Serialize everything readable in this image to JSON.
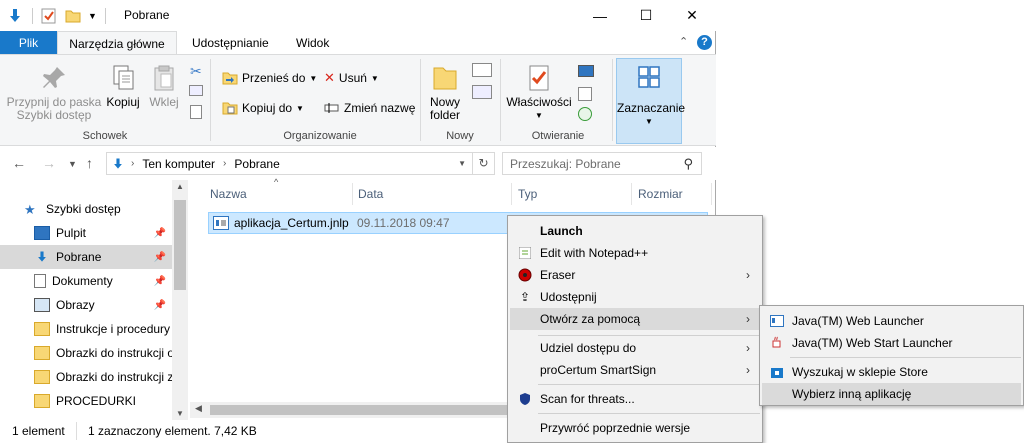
{
  "window": {
    "title": "Pobrane"
  },
  "tabs": {
    "file": "Plik",
    "home": "Narzędzia główne",
    "share": "Udostępnianie",
    "view": "Widok"
  },
  "ribbon": {
    "pin_label_1": "Przypnij do paska",
    "pin_label_2": "Szybki dostęp",
    "copy": "Kopiuj",
    "paste": "Wklej",
    "group_clipboard": "Schowek",
    "move_to": "Przenieś do",
    "copy_to": "Kopiuj do",
    "delete": "Usuń",
    "rename": "Zmień nazwę",
    "group_organize": "Organizowanie",
    "new_folder_1": "Nowy",
    "new_folder_2": "folder",
    "group_new": "Nowy",
    "properties": "Właściwości",
    "group_open": "Otwieranie",
    "select": "Zaznaczanie"
  },
  "address": {
    "crumb_1": "Ten komputer",
    "crumb_2": "Pobrane",
    "search_placeholder": "Przeszukaj: Pobrane"
  },
  "navpane": {
    "items": [
      {
        "label": "Szybki dostęp"
      },
      {
        "label": "Pulpit"
      },
      {
        "label": "Pobrane"
      },
      {
        "label": "Dokumenty"
      },
      {
        "label": "Obrazy"
      },
      {
        "label": "Instrukcje i procedury"
      },
      {
        "label": "Obrazki do instrukcji o"
      },
      {
        "label": "Obrazki do instrukcji z"
      },
      {
        "label": "PROCEDURKI"
      }
    ]
  },
  "filelist": {
    "columns": [
      "Nazwa",
      "Data",
      "Typ",
      "Rozmiar"
    ],
    "rows": [
      {
        "name": "aplikacja_Certum.jnlp",
        "date": "09.11.2018 09:47"
      }
    ]
  },
  "status": {
    "count": "1 element",
    "selected": "1 zaznaczony element. 7,42 KB"
  },
  "context_menu": {
    "items": [
      "Launch",
      "Edit with Notepad++",
      "Eraser",
      "Udostępnij",
      "Otwórz za pomocą",
      "Udziel dostępu do",
      "proCertum SmartSign",
      "Scan for threats...",
      "Przywróć poprzednie wersje"
    ]
  },
  "submenu": {
    "items": [
      "Java(TM) Web Launcher",
      "Java(TM) Web Start Launcher",
      "Wyszukaj w sklepie Store",
      "Wybierz inną aplikację"
    ]
  },
  "colors": {
    "accent": "#1979ca",
    "selection": "#cce8ff",
    "menu_bg": "#f2f2f2"
  }
}
